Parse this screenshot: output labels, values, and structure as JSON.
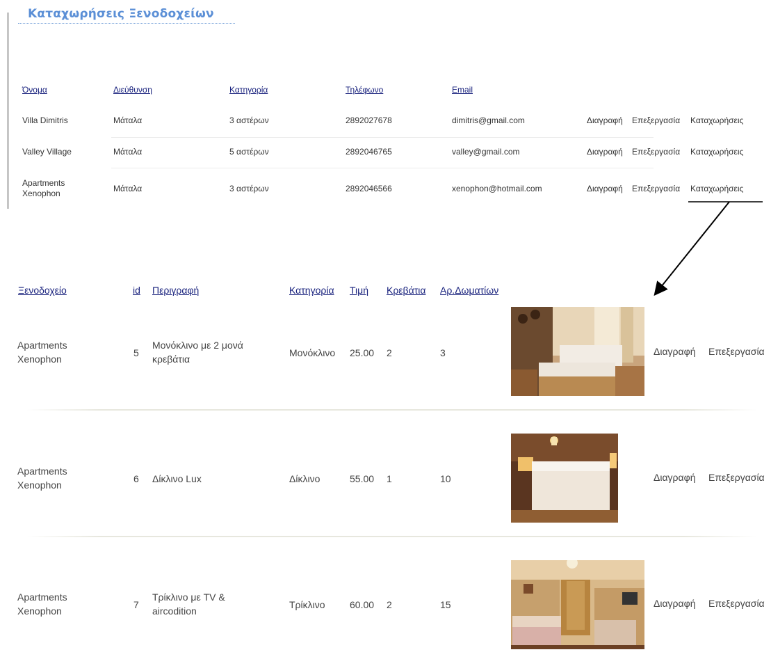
{
  "page_title": "Καταχωρήσεις Ξενοδοχείων",
  "hotels_table": {
    "headers": [
      "Όνομα",
      "Διεύθυνση",
      "Κατηγορία",
      "Τηλέφωνο",
      "Email"
    ],
    "rows": [
      {
        "name": "Villa Dimitris",
        "address": "Μάταλα",
        "category": "3 αστέρων",
        "phone": "2892027678",
        "email": "dimitris@gmail.com"
      },
      {
        "name": "Valley Village",
        "address": "Μάταλα",
        "category": "5 αστέρων",
        "phone": "2892046765",
        "email": "valley@gmail.com"
      },
      {
        "name": "Apartments Xenophon",
        "address": "Μάταλα",
        "category": "3 αστέρων",
        "phone": "2892046566",
        "email": "xenophon@hotmail.com"
      }
    ],
    "actions": {
      "delete": "Διαγραφή",
      "edit": "Επεξεργασία",
      "entries": "Καταχωρήσεις"
    }
  },
  "rooms_table": {
    "headers": [
      "Ξενοδοχείο",
      "id",
      "Περιγραφή",
      "Κατηγορία",
      "Τιμή",
      "Κρεβάτια",
      "Αρ.Δωματίων"
    ],
    "rows": [
      {
        "hotel": "Apartments Xenophon",
        "id": "5",
        "description": "Μονόκλινο με 2 μονά κρεβάτια",
        "category": "Μονόκλινο",
        "price": "25.00",
        "beds": "2",
        "rooms": "3"
      },
      {
        "hotel": "Apartments Xenophon",
        "id": "6",
        "description": "Δίκλινο Lux",
        "category": "Δίκλινο",
        "price": "55.00",
        "beds": "1",
        "rooms": "10"
      },
      {
        "hotel": "Apartments Xenophon",
        "id": "7",
        "description": "Τρίκλινο με TV & aircodition",
        "category": "Τρίκλινο",
        "price": "60.00",
        "beds": "2",
        "rooms": "15"
      }
    ],
    "actions": {
      "delete": "Διαγραφή",
      "edit": "Επεξεργασία"
    }
  },
  "colors": {
    "title": "#5b8fd6",
    "header_link": "#1a237e",
    "text": "#333333"
  }
}
